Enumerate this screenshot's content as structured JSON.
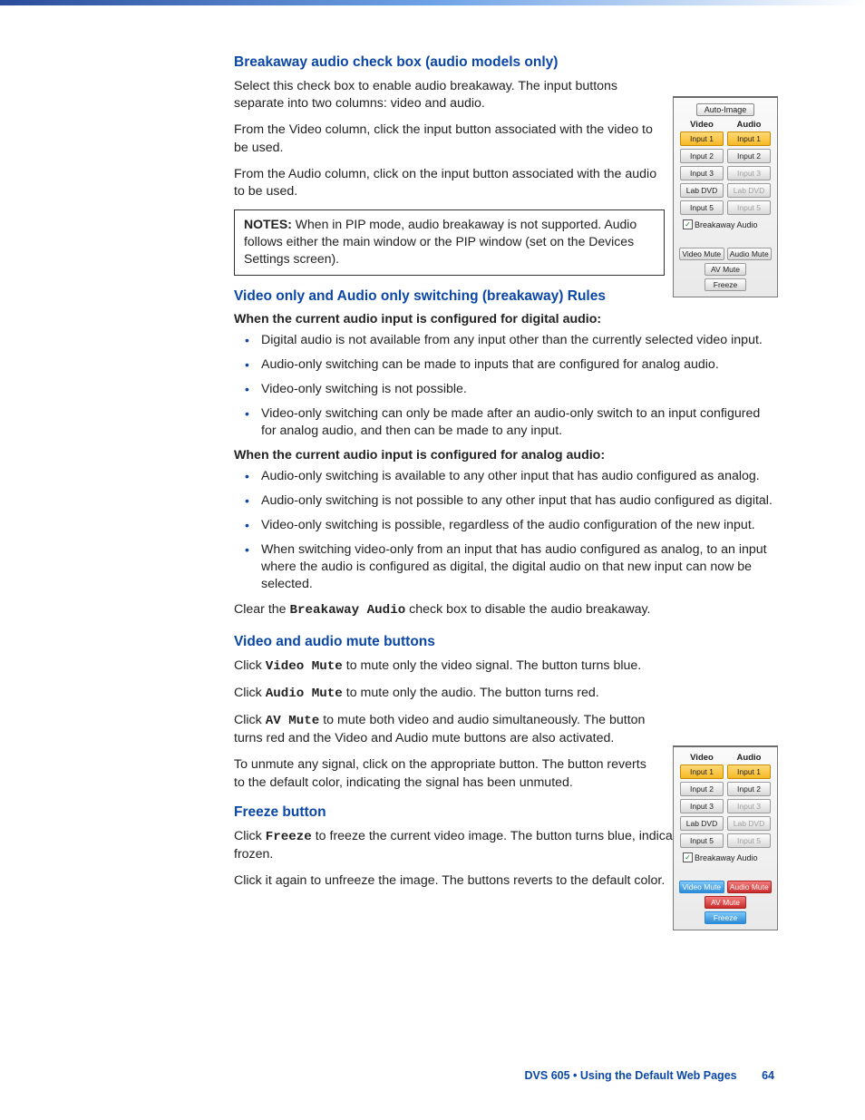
{
  "section1": {
    "title": "Breakaway audio check box (audio models only)",
    "p1": "Select this check box to enable audio breakaway. The input buttons separate into two columns: video and audio.",
    "p2": "From the Video column, click the input button associated with the video to be used.",
    "p3": "From the Audio column, click on the input button associated with the audio to be used.",
    "notes_label": "NOTES:",
    "notes_body": " When in PIP mode, audio breakaway is not supported. Audio follows either the main window or the PIP window (set on the Devices Settings screen)."
  },
  "section2": {
    "title": "Video only and Audio only switching (breakaway) Rules",
    "sub1": "When the current audio input is configured for digital audio:",
    "digital": [
      "Digital audio is not available from any input other than the currently selected video input.",
      "Audio-only switching can be made to inputs that are configured for analog audio.",
      "Video-only switching is not possible.",
      "Video-only switching can only be made after an audio-only switch to an input configured for analog audio, and then can be made to any input."
    ],
    "sub2": "When the current audio input is configured for analog audio:",
    "analog": [
      "Audio-only switching is available to any other input that has audio configured as analog.",
      "Audio-only switching is not possible to any other input that has audio configured as digital.",
      "Video-only switching is possible, regardless of the audio configuration of the new input.",
      "When switching video-only from an input that has audio configured as analog, to an input where the audio is configured as digital, the digital audio on that new input can now be selected."
    ],
    "clear_pre": "Clear the ",
    "clear_mono": "Breakaway Audio",
    "clear_post": " check box to disable the audio breakaway."
  },
  "section3": {
    "title": "Video and audio mute buttons",
    "p1_pre": "Click ",
    "p1_mono": "Video Mute",
    "p1_post": " to mute only the video signal. The button turns blue.",
    "p2_pre": "Click ",
    "p2_mono": "Audio Mute",
    "p2_post": " to mute only the audio. The button turns red.",
    "p3_pre": "Click ",
    "p3_mono": "AV Mute",
    "p3_post": " to mute both video and audio simultaneously. The button turns red and the Video and Audio mute buttons are also activated.",
    "p4": "To unmute any signal, click on the appropriate button. The button reverts to the default color, indicating the signal has been unmuted."
  },
  "section4": {
    "title": "Freeze button",
    "p1_pre": "Click ",
    "p1_mono": "Freeze",
    "p1_post": " to freeze the current video image. The button turns blue, indicating the image is frozen.",
    "p2": "Click it again to unfreeze the image. The buttons reverts to the default color."
  },
  "panel": {
    "auto_image": "Auto-Image",
    "video_head": "Video",
    "audio_head": "Audio",
    "video_inputs": [
      "Input 1",
      "Input 2",
      "Input 3",
      "Lab DVD",
      "Input 5"
    ],
    "audio_inputs": [
      "Input 1",
      "Input 2",
      "Input 3",
      "Lab DVD",
      "Input 5"
    ],
    "breakaway": "Breakaway Audio",
    "video_mute": "Video Mute",
    "audio_mute": "Audio Mute",
    "av_mute": "AV Mute",
    "freeze": "Freeze"
  },
  "footer": {
    "text": "DVS 605 • Using the Default Web Pages",
    "page": "64"
  }
}
